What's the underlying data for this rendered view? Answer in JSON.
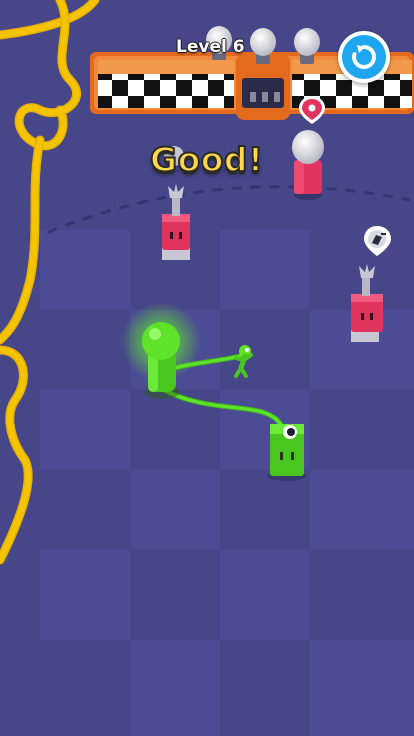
{
  "hud": {
    "level_label": "Level 6",
    "restart_icon": "restart-icon"
  },
  "feedback_text": "Good!",
  "colors": {
    "background": "#4a4a8e",
    "rope_yellow": "#f5c400",
    "player_green": "#5ee22a",
    "socket_pink": "#e0345e",
    "checker_frame": "#ee7a2a",
    "restart_button": "#1ea6ee",
    "feedback_text": "#ffd74a"
  },
  "icons": {
    "location_pin": "map-pin-icon",
    "plug_marker": "plug-icon",
    "bulb": "light-bulb-icon"
  }
}
